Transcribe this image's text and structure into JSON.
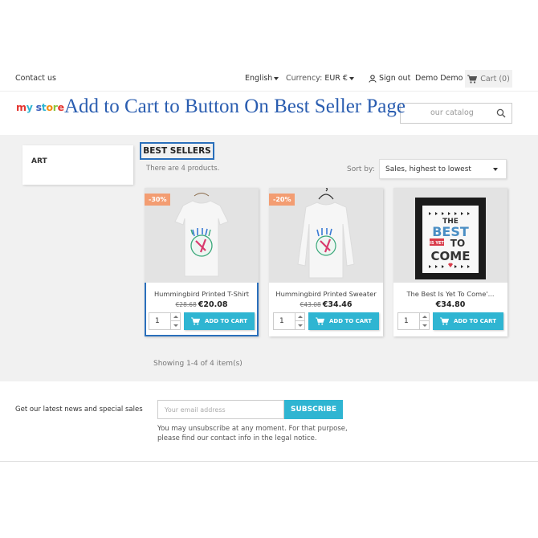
{
  "topnav": {
    "contact": "Contact us",
    "language": "English",
    "currency_label": "Currency:",
    "currency_value": "EUR €",
    "sign_out": "Sign out",
    "user_name": "Demo Demo",
    "cart": "Cart (0)"
  },
  "header": {
    "logo_letters": [
      "m",
      "y",
      " ",
      "s",
      "t",
      "o",
      "r",
      "e"
    ],
    "overlay_title": "Add to Cart to Button On Best Seller Page",
    "search_placeholder": "our catalog"
  },
  "sidebar": {
    "category": "ART"
  },
  "listing": {
    "title": "BEST SELLERS",
    "count_text": "There are 4 products.",
    "sort_label": "Sort by:",
    "sort_value": "Sales, highest to lowest",
    "showing": "Showing 1-4 of 4 item(s)",
    "add_to_cart_label": "ADD TO CART"
  },
  "products": [
    {
      "name": "Hummingbird Printed T-Shirt",
      "old_price": "€28.68",
      "price": "€20.08",
      "discount": "-30%",
      "qty": "1"
    },
    {
      "name": "Hummingbird Printed Sweater",
      "old_price": "€43.08",
      "price": "€34.46",
      "discount": "-20%",
      "qty": "1"
    },
    {
      "name": "The Best Is Yet To Come'...",
      "old_price": "",
      "price": "€34.80",
      "discount": "",
      "qty": "1"
    }
  ],
  "poster_text": {
    "l1": "THE",
    "l2": "BEST",
    "l3": "IS YET",
    "l4": "TO",
    "l5": "COME"
  },
  "newsletter": {
    "text": "Get our latest news and special sales",
    "placeholder": "Your email address",
    "button": "SUBSCRIBE",
    "note_line1": "You may unsubscribe at any moment. For that purpose,",
    "note_line2": "please find our contact info in the legal notice."
  },
  "colors": {
    "accent": "#2fb5d2",
    "highlight_border": "#2a6fbb",
    "badge": "#f39d72",
    "overlay_text": "#2a5db0"
  }
}
